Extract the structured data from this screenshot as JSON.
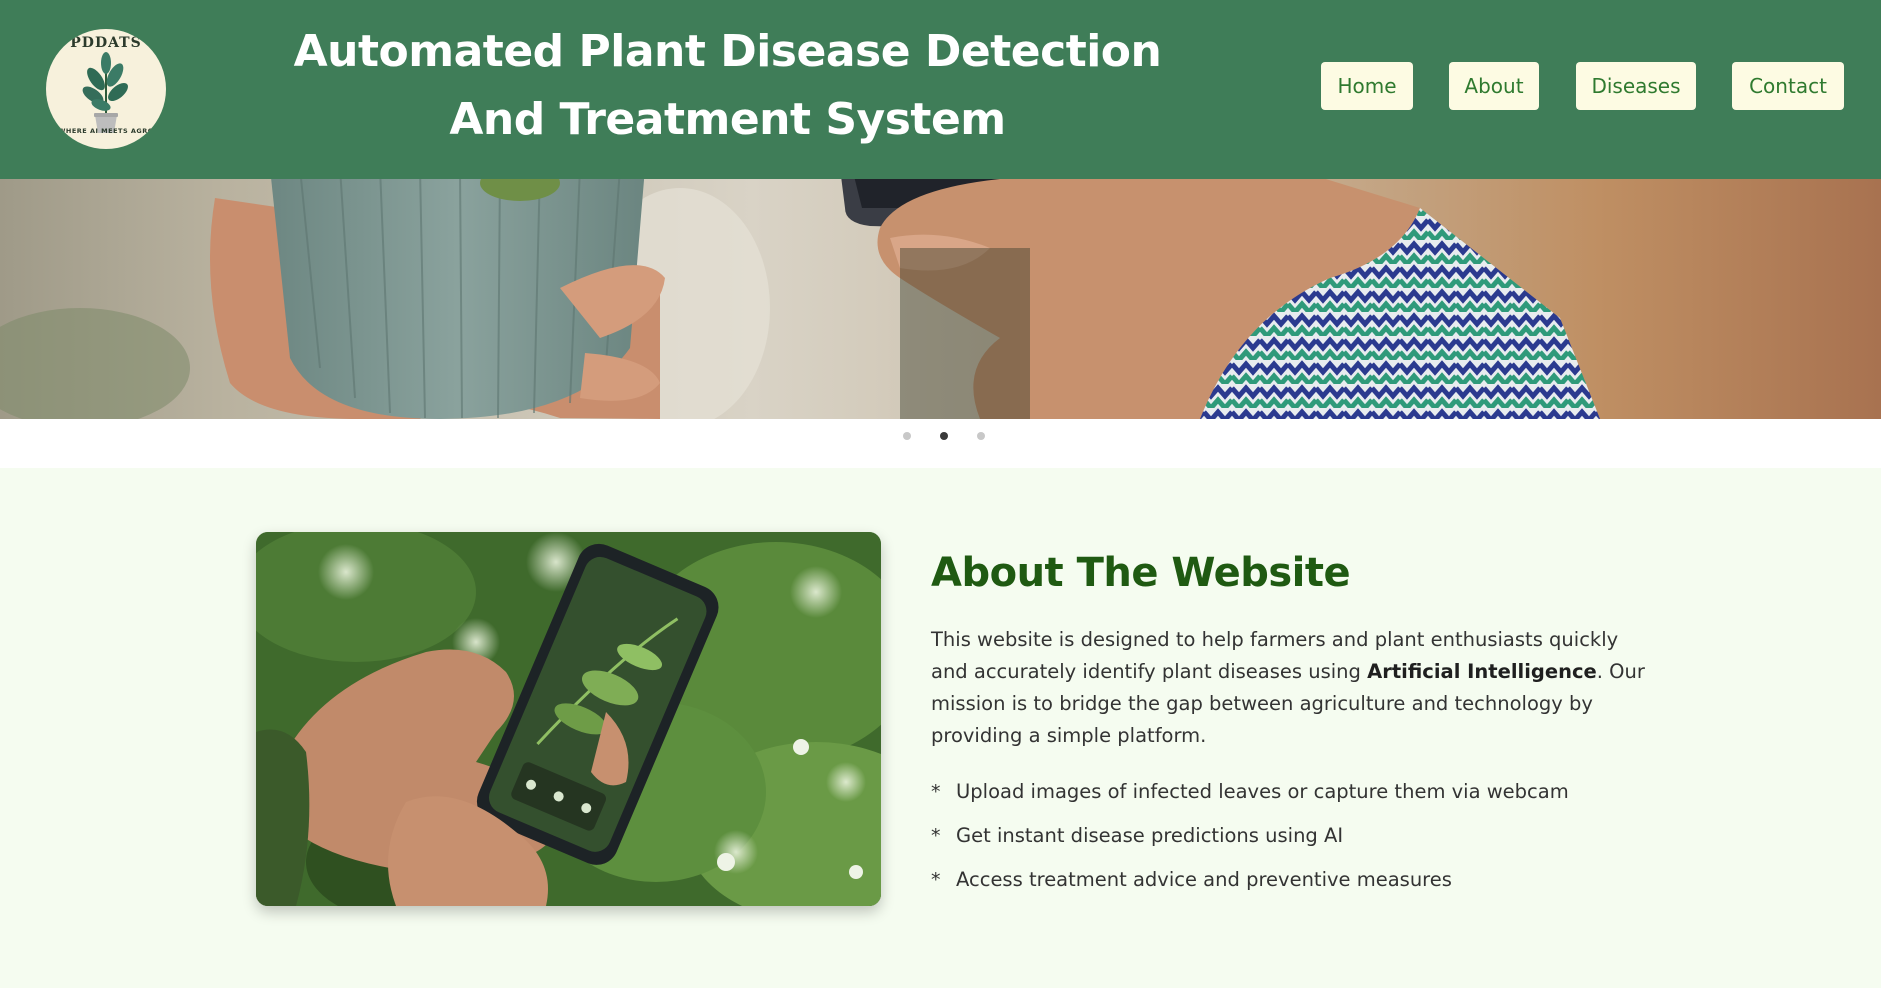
{
  "header": {
    "logo": {
      "top_text": "PDDATS",
      "bottom_text": "WHERE AI MEETS AGRO",
      "icon": "potted-plant-icon"
    },
    "title": "Automated Plant Disease Detection And Treatment System",
    "nav": [
      {
        "label": "Home"
      },
      {
        "label": "About"
      },
      {
        "label": "Diseases"
      },
      {
        "label": "Contact"
      }
    ]
  },
  "carousel": {
    "active_slide": 2,
    "slide_count": 3
  },
  "about": {
    "heading": "About The Website",
    "paragraph_part1": "This website is designed to help farmers and plant enthusiasts quickly and accurately identify plant diseases using ",
    "paragraph_bold": "Artificial Intelligence",
    "paragraph_part2": ". Our mission is to bridge the gap between agriculture and technology by providing a simple platform.",
    "bullet_symbol": "*",
    "features": [
      "Upload images of infected leaves or capture them via webcam",
      "Get instant disease predictions using AI",
      "Access treatment advice and preventive measures"
    ]
  },
  "colors": {
    "header_bg": "#3f7d58",
    "nav_button_bg": "#fdfbe3",
    "nav_button_text": "#2f7a2f",
    "about_bg": "#f5fcf0",
    "heading_green": "#1f5a12"
  }
}
